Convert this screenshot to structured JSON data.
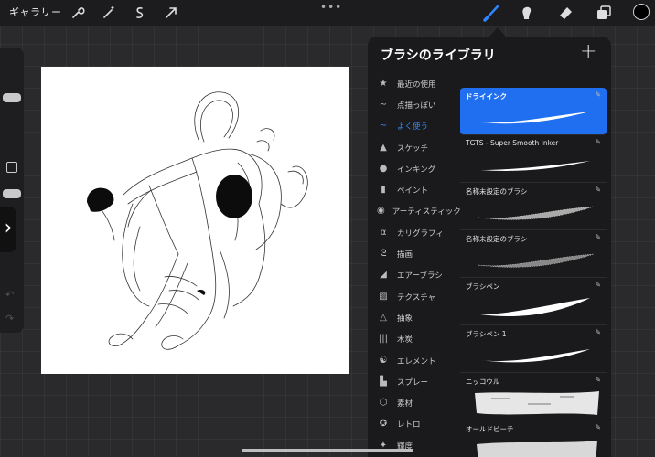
{
  "topbar": {
    "gallery_label": "ギャラリー",
    "left_tools": [
      "wrench-icon",
      "magic-wand-icon",
      "selection-icon",
      "transform-arrow-icon"
    ],
    "more_label": "•••",
    "right_tools": [
      "brush-icon",
      "smudge-icon",
      "eraser-icon",
      "layers-icon"
    ],
    "current_color": "#000000"
  },
  "panel": {
    "title": "ブラシのライブラリ",
    "add_label": "+",
    "categories": [
      {
        "label": "最近の使用",
        "icon": "star-icon",
        "active": false
      },
      {
        "label": "点描っぽい",
        "icon": "stroke-icon",
        "active": false
      },
      {
        "label": "よく使う",
        "icon": "stroke-icon",
        "active": true
      },
      {
        "label": "スケッチ",
        "icon": "pencil-icon",
        "active": false
      },
      {
        "label": "インキング",
        "icon": "ink-drop-icon",
        "active": false
      },
      {
        "label": "ペイント",
        "icon": "paint-brush-icon",
        "active": false
      },
      {
        "label": "アーティスティック",
        "icon": "palette-icon",
        "active": false
      },
      {
        "label": "カリグラフィ",
        "icon": "calligraphy-icon",
        "active": false
      },
      {
        "label": "描画",
        "icon": "loop-stroke-icon",
        "active": false
      },
      {
        "label": "エアーブラシ",
        "icon": "airbrush-icon",
        "active": false
      },
      {
        "label": "テクスチャ",
        "icon": "texture-icon",
        "active": false
      },
      {
        "label": "抽象",
        "icon": "triangle-icon",
        "active": false
      },
      {
        "label": "木炭",
        "icon": "charcoal-icon",
        "active": false
      },
      {
        "label": "エレメント",
        "icon": "yin-yang-icon",
        "active": false
      },
      {
        "label": "スプレー",
        "icon": "spray-can-icon",
        "active": false
      },
      {
        "label": "素材",
        "icon": "cube-icon",
        "active": false
      },
      {
        "label": "レトロ",
        "icon": "retro-star-icon",
        "active": false
      },
      {
        "label": "輝度",
        "icon": "sparkle-icon",
        "active": false
      }
    ],
    "brushes": [
      {
        "name": "ドライインク",
        "selected": true,
        "style": "solid"
      },
      {
        "name": "TGTS - Super Smooth Inker",
        "selected": false,
        "style": "solid"
      },
      {
        "name": "名称未設定のブラシ",
        "selected": false,
        "style": "grain"
      },
      {
        "name": "名称未設定のブラシ",
        "selected": false,
        "style": "grain"
      },
      {
        "name": "ブラシペン",
        "selected": false,
        "style": "solid"
      },
      {
        "name": "ブラシペン 1",
        "selected": false,
        "style": "solid"
      },
      {
        "name": "ニッコウル",
        "selected": false,
        "style": "rough"
      },
      {
        "name": "オールドビーチ",
        "selected": false,
        "style": "rough"
      }
    ],
    "edit_icon": "pencil-edit-icon"
  },
  "colors": {
    "accent": "#1f6ff0",
    "active_category": "#3b8cff",
    "panel_bg": "#1a1a1c",
    "canvas_bg": "#ffffff"
  }
}
